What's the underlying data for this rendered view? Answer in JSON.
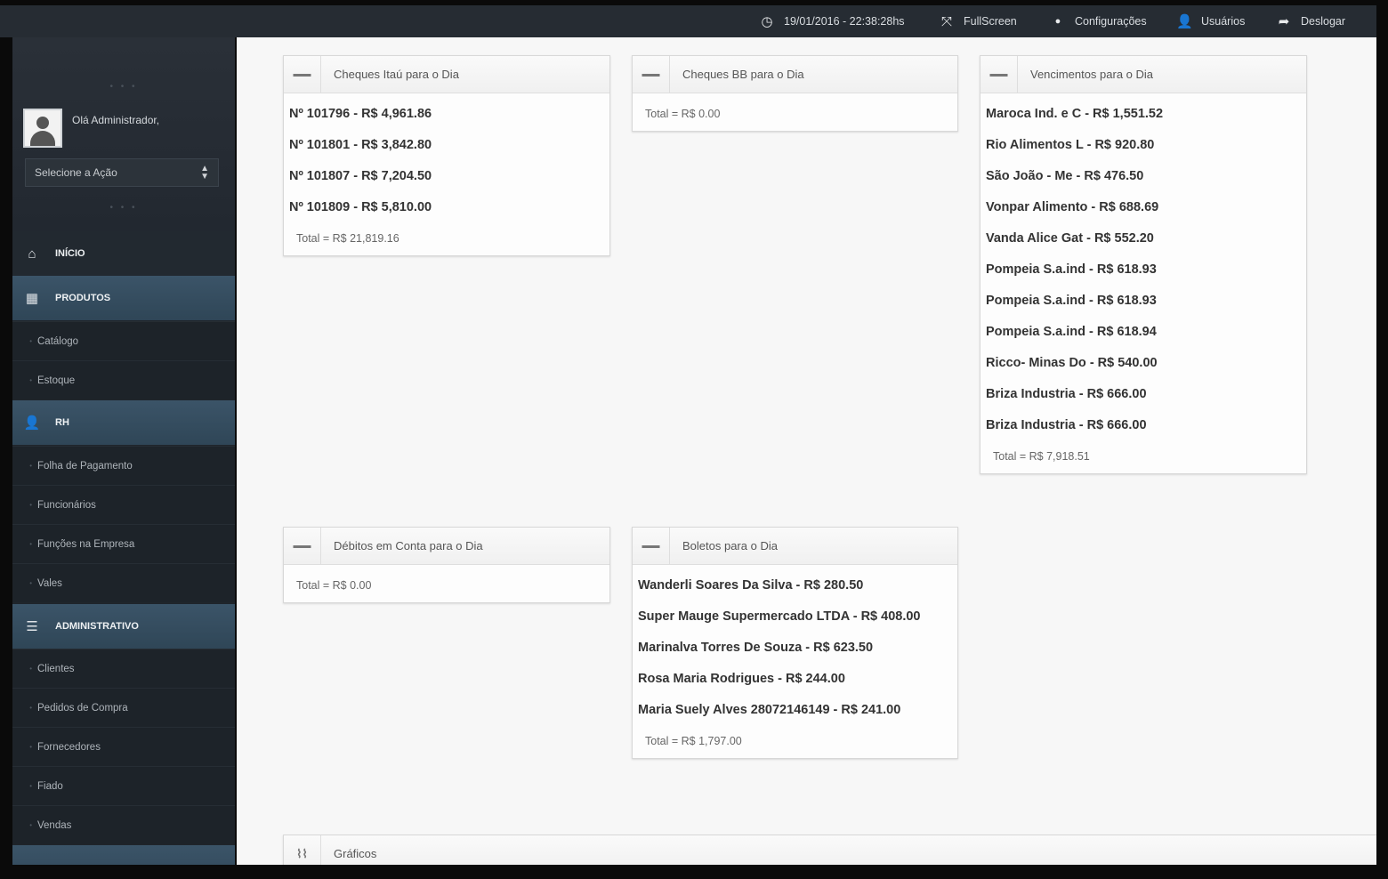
{
  "topbar": {
    "datetime": "19/01/2016 - 22:38:28hs",
    "fullscreen": "FullScreen",
    "settings": "Configurações",
    "users": "Usuários",
    "logout": "Deslogar"
  },
  "sidebar": {
    "greeting": "Olá Administrador,",
    "action_select": "Selecione a Ação",
    "home": "INÍCIO",
    "produtos": {
      "label": "PRODUTOS",
      "items": [
        "Catálogo",
        "Estoque"
      ]
    },
    "rh": {
      "label": "RH",
      "items": [
        "Folha de Pagamento",
        "Funcionários",
        "Funções na Empresa",
        "Vales"
      ]
    },
    "administrativo": {
      "label": "ADMINISTRATIVO",
      "items": [
        "Clientes",
        "Pedidos de Compra",
        "Fornecedores",
        "Fiado",
        "Vendas"
      ]
    }
  },
  "widgets": {
    "cheques_itau": {
      "title": "Cheques Itaú para o Dia",
      "items": [
        "Nº 101796 - R$ 4,961.86",
        "Nº 101801 - R$ 3,842.80",
        "Nº 101807 - R$ 7,204.50",
        "Nº 101809 - R$ 5,810.00"
      ],
      "total": "Total = R$ 21,819.16"
    },
    "cheques_bb": {
      "title": "Cheques BB para o Dia",
      "total": "Total = R$ 0.00"
    },
    "vencimentos": {
      "title": "Vencimentos para o Dia",
      "items": [
        "Maroca Ind. e C - R$ 1,551.52",
        "Rio Alimentos L - R$ 920.80",
        "São João - Me - R$ 476.50",
        "Vonpar Alimento - R$ 688.69",
        "Vanda Alice Gat - R$ 552.20",
        "Pompeia S.a.ind - R$ 618.93",
        "Pompeia S.a.ind - R$ 618.93",
        "Pompeia S.a.ind - R$ 618.94",
        "Ricco- Minas Do - R$ 540.00",
        "Briza Industria - R$ 666.00",
        "Briza Industria - R$ 666.00"
      ],
      "total": "Total = R$ 7,918.51"
    },
    "debitos": {
      "title": "Débitos em Conta para o Dia",
      "total": "Total = R$ 0.00"
    },
    "boletos": {
      "title": "Boletos para o Dia",
      "items": [
        "Wanderli Soares Da Silva - R$ 280.50",
        "Super Mauge Supermercado LTDA - R$ 408.00",
        "Marinalva Torres De Souza - R$ 623.50",
        "Rosa Maria Rodrigues - R$ 244.00",
        "Maria Suely Alves 28072146149 - R$ 241.00"
      ],
      "total": "Total = R$ 1,797.00"
    },
    "graficos": {
      "title": "Gráficos"
    }
  }
}
